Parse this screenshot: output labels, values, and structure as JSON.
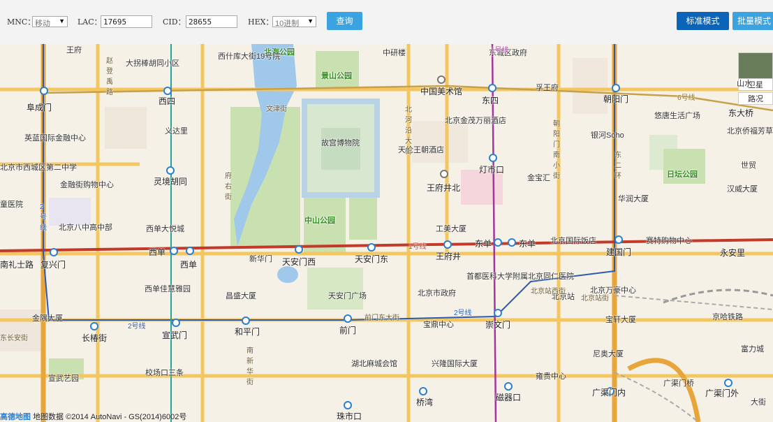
{
  "toolbar": {
    "mnc_label": "MNC：",
    "mnc_value": "移动",
    "lac_label": "LAC：",
    "lac_value": "17695",
    "cid_label": "CID：",
    "cid_value": "28655",
    "hex_label": "HEX：",
    "hex_value": "10进制",
    "query_label": "查询",
    "standard_mode_label": "标准模式",
    "batch_mode_label": "批量模式",
    "query_color": "#3aa3e0",
    "standard_color": "#0c64b8",
    "batch_color": "#3aa3e0"
  },
  "map_type": {
    "satellite": "卫星",
    "road": "路况"
  },
  "attribution": {
    "logo": "高德地图",
    "text": "地图数据 ©2014 AutoNavi - GS(2014)6002号"
  },
  "labels": {
    "l1": "北海公园",
    "l2": "景山公园",
    "l3": "故宫博物院",
    "l4": "中山公园",
    "l5": "日坛公园",
    "l6": "中国美术馆",
    "l7": "东四",
    "l8": "西四",
    "l9": "阜成门",
    "l10": "朝阳门",
    "l11": "东大桥",
    "l12": "灵境胡同",
    "l13": "王府井北",
    "l14": "灯市口",
    "l15": "复兴门",
    "l16": "西单",
    "l17": "西单",
    "l18": "天安门西",
    "l19": "天安门东",
    "l20": "王府井",
    "l21": "东单",
    "l22": "东单",
    "l23": "建国门",
    "l24": "永安里",
    "l25": "南礼士路",
    "l26": "长椿街",
    "l27": "宣武门",
    "l28": "和平门",
    "l29": "前门",
    "l30": "崇文门",
    "l31": "珠市口",
    "l32": "桥湾",
    "l33": "磁器口",
    "l34": "广渠门内",
    "l35": "广渠门外",
    "l36": "中研楼",
    "l37": "东城区政府",
    "l38": "大拐棒胡同小区",
    "l39": "西什库大街19号院",
    "l40": "孚王府",
    "l41": "北京金茂万丽酒店",
    "l42": "天伦王朝酒店",
    "l43": "悠唐生活广场",
    "l44": "银河Soho",
    "l45": "北京侨福芳草地购物中心",
    "l46": "英蓝国际金融中心",
    "l47": "金融街购物中心",
    "l48": "北京八中高中部",
    "l49": "西单大悦城",
    "l50": "金宝汇",
    "l51": "华润大厦",
    "l52": "工美大厦",
    "l53": "北京国际饭店",
    "l54": "赛特购物中心",
    "l55": "首都医科大学附属北京同仁医院",
    "l56": "北京市政府",
    "l57": "北京站",
    "l58": "北京万豪中心",
    "l59": "西单佳慧雅园",
    "l60": "昌盛大厦",
    "l61": "天安门广场",
    "l62": "新华门",
    "l63": "金隅大厦",
    "l64": "宝鼎中心",
    "l65": "宝轩大厦",
    "l66": "尼奥大厦",
    "l67": "湖北麻城会馆",
    "l68": "兴隆国际大厦",
    "l69": "雍贵中心",
    "l70": "宣武艺园",
    "l71": "校场口三条",
    "l72": "京哈铁路",
    "l73": "世贸",
    "l74": "汉威大厦",
    "l75": "山水",
    "l76": "富力城",
    "l77": "广渠门桥",
    "l78": "1号线",
    "l79": "2号线",
    "l80": "6号线",
    "l81": "文津街",
    "l82": "前门东大街",
    "l83": "北京站西街",
    "l84": "东长安街",
    "l85": "北河沿大街",
    "l86": "府右街",
    "l87": "南新华街",
    "l88": "朝阳门南小街",
    "l89": "东二环",
    "l90": "北京市西城区第二中学",
    "l91": "童医院",
    "l92": "义达里",
    "l93": "王府",
    "l94": "大街",
    "l95": "2号线",
    "l96": "2号线",
    "l97": "1号线",
    "l98": "赵登禹路",
    "l99": "北京站街"
  },
  "colors": {
    "line1": "#c23a2a",
    "line2": "#2a5bb0",
    "line5": "#a0379a",
    "line6": "#c7a04a",
    "line4": "#25a39a",
    "park": "#c9e0b0",
    "water": "#9fc8ea",
    "palace": "#b8d2e6",
    "arterial": "#f4c660"
  }
}
